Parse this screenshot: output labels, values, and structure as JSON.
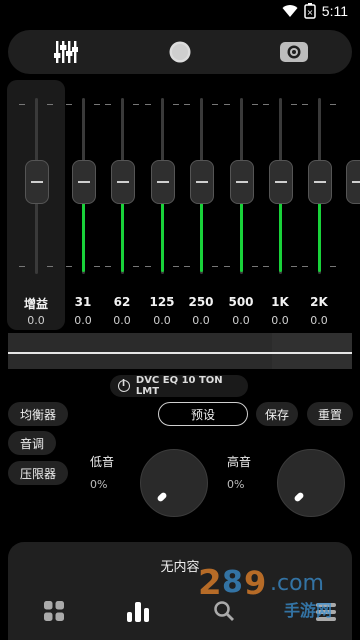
{
  "status_bar": {
    "time": "5:11"
  },
  "toolbar": {
    "items": [
      {
        "name": "equalizer"
      },
      {
        "name": "knob"
      },
      {
        "name": "surround"
      }
    ]
  },
  "eq": {
    "gain_label": "增益",
    "gain_value": "0.0",
    "bands": [
      {
        "freq": "31",
        "value": "0.0"
      },
      {
        "freq": "62",
        "value": "0.0"
      },
      {
        "freq": "125",
        "value": "0.0"
      },
      {
        "freq": "250",
        "value": "0.0"
      },
      {
        "freq": "500",
        "value": "0.0"
      },
      {
        "freq": "1K",
        "value": "0.0"
      },
      {
        "freq": "2K",
        "value": "0.0"
      }
    ]
  },
  "preset_info": {
    "text": "DVC EQ 10 TON LMT"
  },
  "modes": {
    "equalizer": "均衡器",
    "tone": "音调",
    "limiter": "压限器"
  },
  "actions": {
    "preset": "预设",
    "save": "保存",
    "reset": "重置"
  },
  "bass": {
    "label": "低音",
    "value": "0%"
  },
  "treble": {
    "label": "高音",
    "value": "0%"
  },
  "player": {
    "now_playing": "无内容"
  },
  "watermark": {
    "brand": "2",
    "text": "手游网"
  },
  "colors": {
    "accent": "#19d23a",
    "background": "#000000",
    "panel": "#202020"
  }
}
